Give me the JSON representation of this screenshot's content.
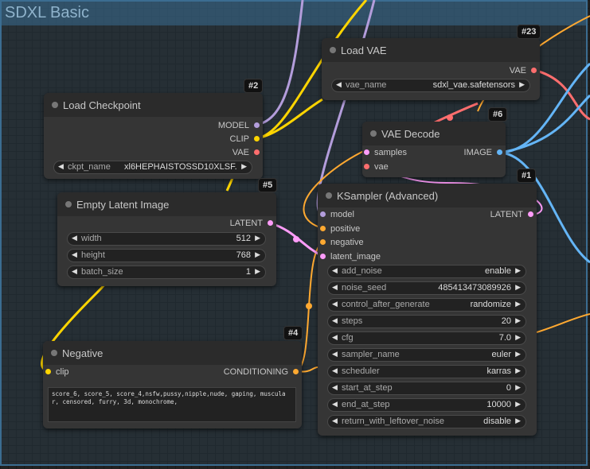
{
  "group": {
    "title": "SDXL Basic"
  },
  "colors": {
    "model": "#b39ddb",
    "clip": "#ffd500",
    "vae": "#ff6e6e",
    "latent": "#ff9cf9",
    "conditioning": "#ffa931",
    "image": "#64b5f6"
  },
  "nodes": {
    "load_checkpoint": {
      "badge": "#2",
      "title": "Load Checkpoint",
      "outputs": [
        "MODEL",
        "CLIP",
        "VAE"
      ],
      "widget": {
        "label": "ckpt_name",
        "value": "xl6HEPHAISTOSSD10XLSF..."
      }
    },
    "load_vae": {
      "badge": "#23",
      "title": "Load VAE",
      "outputs": [
        "VAE"
      ],
      "widget": {
        "label": "vae_name",
        "value": "sdxl_vae.safetensors"
      }
    },
    "vae_decode": {
      "badge": "#6",
      "title": "VAE Decode",
      "inputs": [
        "samples",
        "vae"
      ],
      "outputs": [
        "IMAGE"
      ]
    },
    "empty_latent": {
      "badge": "#5",
      "title": "Empty Latent Image",
      "outputs": [
        "LATENT"
      ],
      "widgets": [
        {
          "label": "width",
          "value": "512"
        },
        {
          "label": "height",
          "value": "768"
        },
        {
          "label": "batch_size",
          "value": "1"
        }
      ]
    },
    "ksampler": {
      "badge": "#1",
      "title": "KSampler (Advanced)",
      "inputs": [
        "model",
        "positive",
        "negative",
        "latent_image"
      ],
      "outputs": [
        "LATENT"
      ],
      "widgets": [
        {
          "label": "add_noise",
          "value": "enable"
        },
        {
          "label": "noise_seed",
          "value": "485413473089926"
        },
        {
          "label": "control_after_generate",
          "value": "randomize"
        },
        {
          "label": "steps",
          "value": "20"
        },
        {
          "label": "cfg",
          "value": "7.0"
        },
        {
          "label": "sampler_name",
          "value": "euler"
        },
        {
          "label": "scheduler",
          "value": "karras"
        },
        {
          "label": "start_at_step",
          "value": "0"
        },
        {
          "label": "end_at_step",
          "value": "10000"
        },
        {
          "label": "return_with_leftover_noise",
          "value": "disable"
        }
      ]
    },
    "negative": {
      "badge": "#4",
      "title": "Negative",
      "inputs": [
        "clip"
      ],
      "outputs": [
        "CONDITIONING"
      ],
      "text": "score_6, score_5, score_4,nsfw,pussy,nipple,nude, gaping, muscular, censored, furry, 3d, monochrome,"
    }
  }
}
